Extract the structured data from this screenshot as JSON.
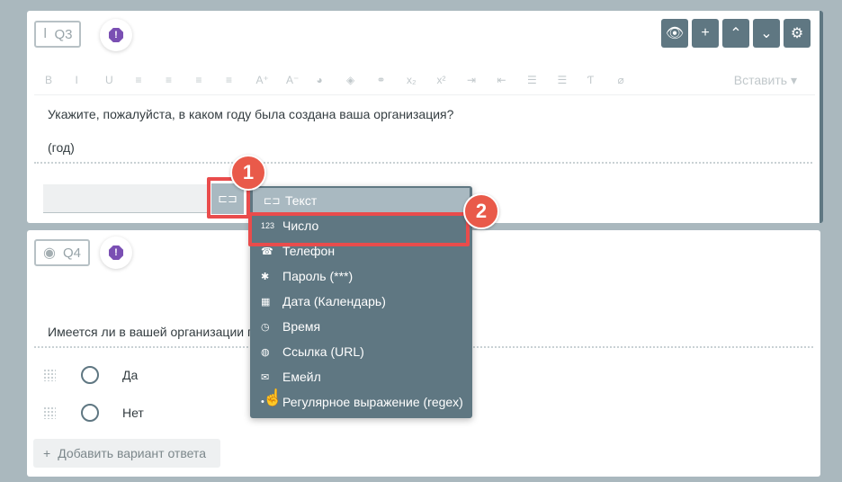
{
  "q3": {
    "badge": "Q3",
    "warning_symbol": "!",
    "toolbar_buttons": [
      {
        "icon": "eye-icon",
        "glyph": "👁"
      },
      {
        "icon": "plus-icon",
        "glyph": "+"
      },
      {
        "icon": "chevron-up-icon",
        "glyph": "⌃"
      },
      {
        "icon": "chevron-down-icon",
        "glyph": "⌄"
      },
      {
        "icon": "gear-icon",
        "glyph": "⚙"
      }
    ],
    "editor_tools": [
      "B",
      "I",
      "U",
      "≡",
      "≡",
      "≡",
      "≡",
      "A⁺",
      "A⁻",
      "◕",
      "◈",
      "⚭",
      "x₂",
      "x²",
      "⇥",
      "⇤",
      "☰",
      "☰",
      "Ƭ",
      "⌀"
    ],
    "insert_label": "Вставить ▾",
    "question_line1": "Укажите, пожалуйста, в каком году была создана ваша организация?",
    "question_line2": "(год)",
    "type_button_glyph": "⊏⊐"
  },
  "menu": {
    "items": [
      {
        "icon": "text-field-icon",
        "glyph": "⊏⊐",
        "label": "Текст"
      },
      {
        "icon": "number-icon",
        "glyph": "123",
        "label": "Число"
      },
      {
        "icon": "phone-icon",
        "glyph": "☎",
        "label": "Телефон"
      },
      {
        "icon": "password-icon",
        "glyph": "✱",
        "label": "Пароль (***)"
      },
      {
        "icon": "calendar-icon",
        "glyph": "▦",
        "label": "Дата (Календарь)"
      },
      {
        "icon": "clock-icon",
        "glyph": "◷",
        "label": "Время"
      },
      {
        "icon": "globe-icon",
        "glyph": "◍",
        "label": "Ссылка (URL)"
      },
      {
        "icon": "mail-icon",
        "glyph": "✉",
        "label": "Емейл"
      },
      {
        "icon": "regex-icon",
        "glyph": "•",
        "label": "Регулярное выражение (regex)"
      }
    ]
  },
  "q4": {
    "badge": "Q4",
    "warning_symbol": "!",
    "question_text": "Имеется ли в вашей организации п",
    "options": [
      "Да",
      "Нет"
    ],
    "add_option_label": "Добавить вариант ответа"
  },
  "markers": [
    "1",
    "2"
  ],
  "colors": {
    "accent": "#5f7782",
    "menu_active": "#a9b9c1",
    "highlight": "#e94c4c",
    "marker": "#e95a4a",
    "warning": "#7a4fb3"
  }
}
